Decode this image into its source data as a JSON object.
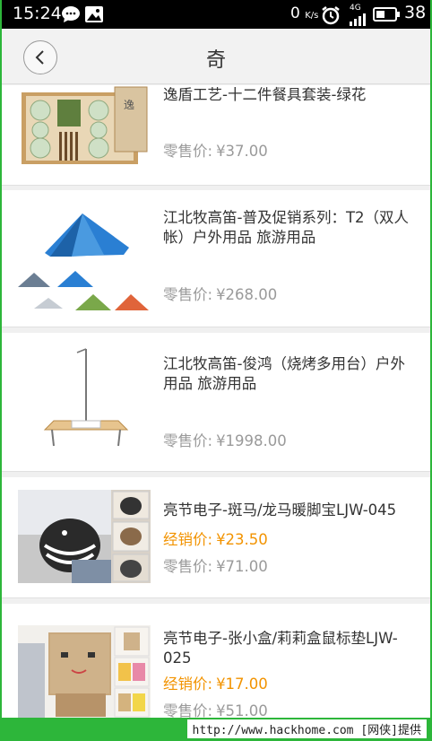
{
  "status_bar": {
    "time": "15:24",
    "net_speed": "0",
    "net_unit": "K/s",
    "network_type": "4G",
    "battery": "38"
  },
  "header": {
    "title": "奇"
  },
  "products": [
    {
      "name": "逸盾工艺-十二件餐具套装-绿花",
      "retail_label": "零售价:",
      "retail_price": "¥37.00",
      "image": "tableware-set"
    },
    {
      "name": "江北牧高笛-普及促销系列：T2（双人帐）户外用品 旅游用品",
      "retail_label": "零售价:",
      "retail_price": "¥268.00",
      "image": "tents"
    },
    {
      "name": "江北牧高笛-俊鸿（烧烤多用台）户外用品 旅游用品",
      "retail_label": "零售价:",
      "retail_price": "¥1998.00",
      "image": "bbq-table"
    },
    {
      "name": "亮节电子-斑马/龙马暖脚宝LJW-045",
      "promo_label": "经销价:",
      "promo_price": "¥23.50",
      "retail_label": "零售价:",
      "retail_price": "¥71.00",
      "image": "foot-warmer"
    },
    {
      "name": "亮节电子-张小盒/莉莉盒鼠标垫LJW-025",
      "promo_label": "经销价:",
      "promo_price": "¥17.00",
      "retail_label": "零售价:",
      "retail_price": "¥51.00",
      "image": "box-mousepad"
    }
  ],
  "watermark": "http://www.hackhome.com [网侠]提供",
  "colors": {
    "promo": "#f29300",
    "retail": "#9a9a9a",
    "frame": "#2db63a"
  }
}
